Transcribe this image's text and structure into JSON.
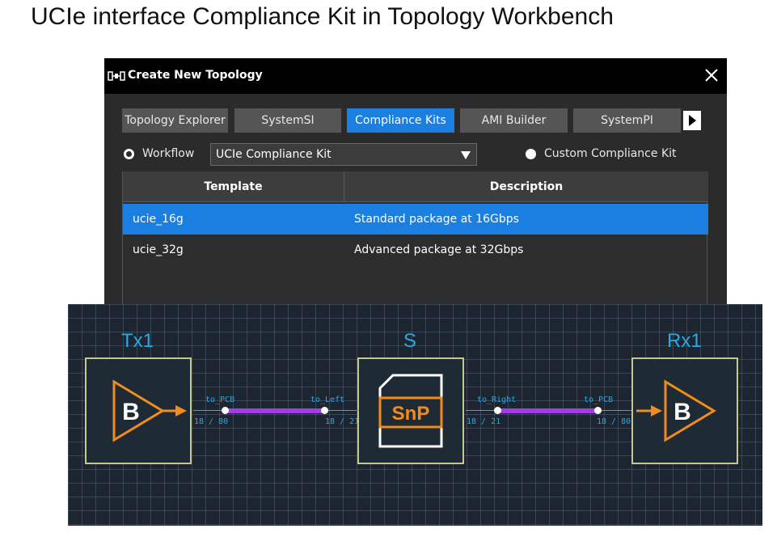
{
  "slide_title": "UCIe  interface Compliance Kit in Topology Workbench",
  "dialog": {
    "title": "Create New Topology",
    "close_icon": "close-icon",
    "tabs": [
      {
        "label": "Topology Explorer",
        "active": false
      },
      {
        "label": "SystemSI",
        "active": false
      },
      {
        "label": "Compliance Kits",
        "active": true
      },
      {
        "label": "AMI Builder",
        "active": false
      },
      {
        "label": "SystemPI",
        "active": false
      }
    ],
    "workflow_label": "Workflow",
    "workflow_select": "UCIe Compliance Kit",
    "custom_label": "Custom Compliance Kit",
    "table": {
      "headers": [
        "Template",
        "Description"
      ],
      "rows": [
        {
          "template": "ucie_16g",
          "description": "Standard package at 16Gbps",
          "selected": true
        },
        {
          "template": "ucie_32g",
          "description": "Advanced package at 32Gbps",
          "selected": false
        }
      ]
    }
  },
  "schematic": {
    "blocks": {
      "tx": {
        "label": "Tx1",
        "glyph": "B"
      },
      "s": {
        "label": "S",
        "glyph": "SnP"
      },
      "rx": {
        "label": "Rx1",
        "glyph": "B"
      }
    },
    "ports": {
      "tx_out": "to_PCB",
      "tx_out_pins": "18 / 80",
      "s_left": "to_Left",
      "s_left_pins": "18 / 21",
      "s_right": "to_Right",
      "s_right_pins": "18 / 21",
      "rx_in": "to_PCB",
      "rx_in_pins": "18 / 80"
    },
    "colors": {
      "label": "#2aa8e8",
      "wire": "#a03ce8",
      "block_border": "#c8c88c",
      "glyph": "#f08c1e"
    }
  }
}
